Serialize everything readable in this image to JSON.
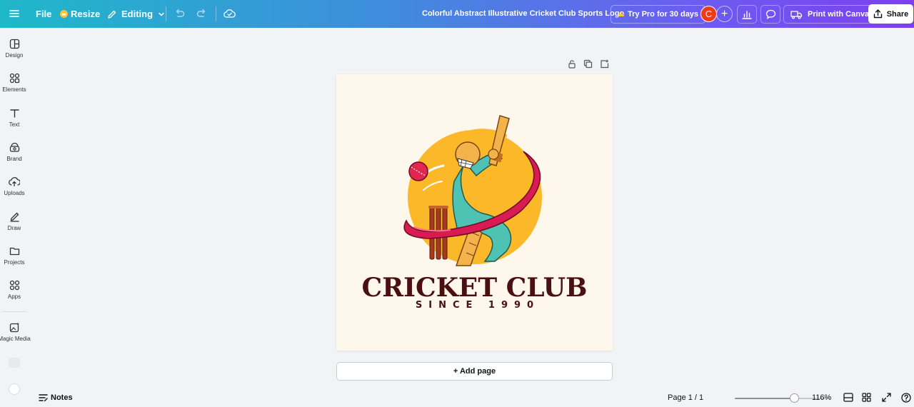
{
  "topbar": {
    "file_label": "File",
    "resize_label": "Resize",
    "editing_label": "Editing",
    "doc_title": "Colorful Abstract Illustrative Cricket Club Sports Logo",
    "try_pro_label": "Try Pro for 30 days",
    "avatar_initial": "C",
    "print_label": "Print with Canva",
    "share_label": "Share"
  },
  "sidebar": {
    "items": [
      {
        "label": "Design",
        "icon": "layout-icon"
      },
      {
        "label": "Elements",
        "icon": "shapes-icon"
      },
      {
        "label": "Text",
        "icon": "text-icon"
      },
      {
        "label": "Brand",
        "icon": "brand-icon"
      },
      {
        "label": "Uploads",
        "icon": "cloud-upload-icon"
      },
      {
        "label": "Draw",
        "icon": "pen-icon"
      },
      {
        "label": "Projects",
        "icon": "folder-icon"
      },
      {
        "label": "Apps",
        "icon": "apps-grid-icon"
      },
      {
        "label": "Magic Media",
        "icon": "magic-image-icon"
      }
    ]
  },
  "design": {
    "title": "CRICKET CLUB",
    "subtitle": "SINCE 1990"
  },
  "add_page_label": "+ Add page",
  "bottombar": {
    "notes_label": "Notes",
    "page_indicator": "Page 1 / 1",
    "zoom_label": "116%",
    "zoom_fraction": 0.62
  },
  "colors": {
    "topbar_start": "#1fb8c9",
    "topbar_end": "#7d3ff0",
    "logo_text": "#4a0f10",
    "logo_circle": "#fbb829",
    "swoosh": "#d81b52",
    "batsman": "#4fc3b3",
    "page_bg": "#fdf7ec"
  }
}
